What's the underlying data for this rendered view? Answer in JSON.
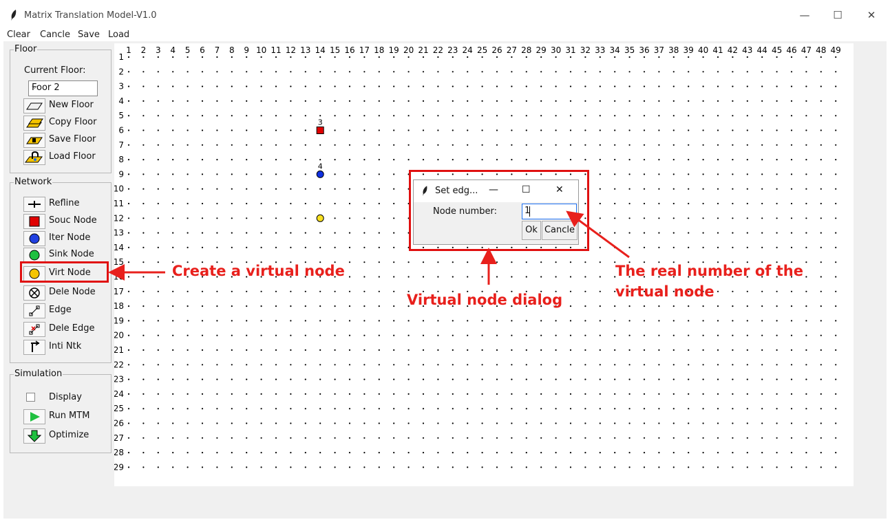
{
  "window": {
    "title": "Matrix Translation Model-V1.0",
    "minimize": "—",
    "maximize": "☐",
    "close": "✕"
  },
  "menu": [
    "Clear",
    "Cancle",
    "Save",
    "Load"
  ],
  "floor": {
    "frame_label": "Floor",
    "current_label": "Current Floor:",
    "selected": "Foor 2",
    "tools": [
      {
        "label": "New Floor",
        "icon": "new-floor-icon"
      },
      {
        "label": "Copy Floor",
        "icon": "copy-floor-icon"
      },
      {
        "label": "Save Floor",
        "icon": "save-floor-icon"
      },
      {
        "label": "Load Floor",
        "icon": "load-floor-icon"
      }
    ]
  },
  "network": {
    "frame_label": "Network",
    "tools": [
      {
        "label": "Refline",
        "icon": "refline-icon"
      },
      {
        "label": "Souc Node",
        "icon": "source-node-icon"
      },
      {
        "label": "Iter Node",
        "icon": "iter-node-icon"
      },
      {
        "label": "Sink Node",
        "icon": "sink-node-icon"
      },
      {
        "label": "Virt Node",
        "icon": "virtual-node-icon"
      },
      {
        "label": "Dele Node",
        "icon": "delete-node-icon"
      },
      {
        "label": "Edge",
        "icon": "edge-icon"
      },
      {
        "label": "Dele Edge",
        "icon": "delete-edge-icon"
      },
      {
        "label": "Inti Ntk",
        "icon": "init-network-icon"
      }
    ]
  },
  "simulation": {
    "frame_label": "Simulation",
    "display_label": "Display",
    "display_checked": false,
    "tools": [
      {
        "label": "Run MTM",
        "icon": "play-icon"
      },
      {
        "label": "Optimize",
        "icon": "down-arrow-icon"
      }
    ]
  },
  "grid": {
    "columns": 49,
    "rows": 29
  },
  "nodes": [
    {
      "type": "source",
      "label": "3",
      "col": 14,
      "row": 6,
      "color": "#e00000"
    },
    {
      "type": "iter",
      "label": "4",
      "col": 14,
      "row": 9,
      "color": "#1030e0"
    },
    {
      "type": "virtual",
      "label": "",
      "col": 14,
      "row": 12,
      "color": "#f8e020"
    }
  ],
  "dialog": {
    "title": "Set edg...",
    "field_label": "Node number:",
    "field_value": "1",
    "ok_label": "Ok",
    "cancel_label": "Cancle"
  },
  "annotations": {
    "create": "Create a virtual node",
    "dialog": "Virtual node dialog",
    "real_number_line1": "The real number of the",
    "real_number_line2": "virtual node",
    "color": "#e8201c"
  }
}
